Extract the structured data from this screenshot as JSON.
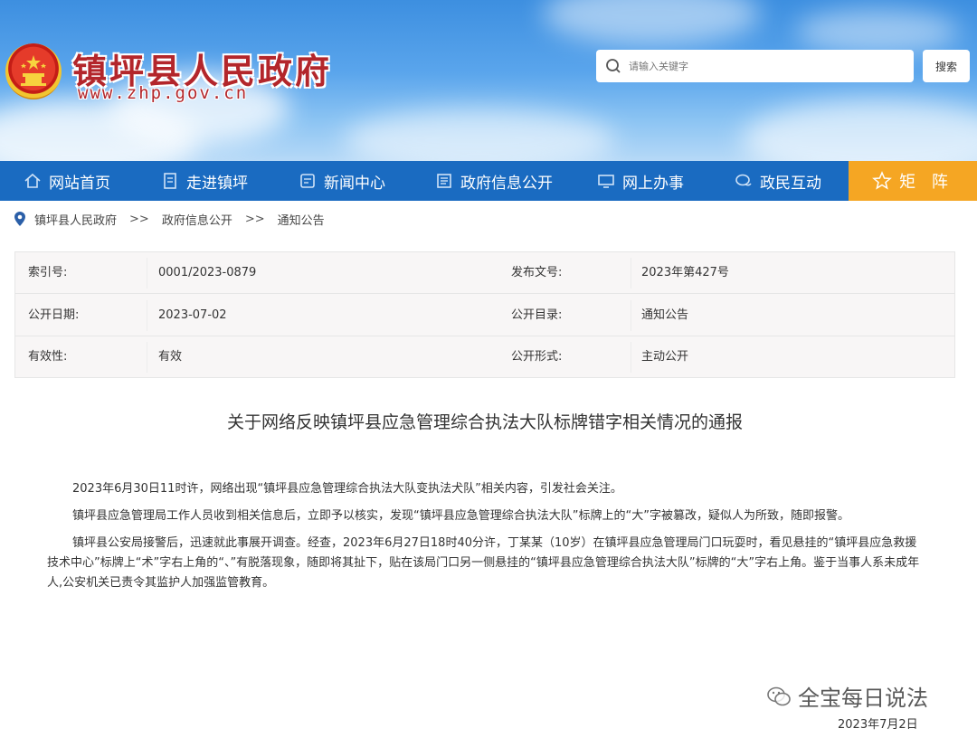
{
  "header": {
    "site_title": "镇坪县人民政府",
    "site_url": "www.zhp.gov.cn",
    "search_placeholder": "请输入关键字",
    "search_button": "搜索"
  },
  "nav": {
    "items": [
      {
        "label": "网站首页",
        "icon": "home-icon"
      },
      {
        "label": "走进镇坪",
        "icon": "document-icon"
      },
      {
        "label": "新闻中心",
        "icon": "news-icon"
      },
      {
        "label": "政府信息公开",
        "icon": "info-icon"
      },
      {
        "label": "网上办事",
        "icon": "monitor-icon"
      },
      {
        "label": "政民互动",
        "icon": "chat-icon"
      },
      {
        "label": "矩 阵",
        "icon": "star-icon"
      }
    ],
    "highlight_color": "#f5a623",
    "bar_color": "#1a6bc1"
  },
  "breadcrumb": {
    "items": [
      "镇坪县人民政府",
      "政府信息公开",
      "通知公告"
    ],
    "separator": ">>"
  },
  "meta": {
    "rows": [
      {
        "label1": "索引号:",
        "value1": "0001/2023-0879",
        "label2": "发布文号:",
        "value2": "2023年第427号"
      },
      {
        "label1": "公开日期:",
        "value1": "2023-07-02",
        "label2": "公开目录:",
        "value2": "通知公告"
      },
      {
        "label1": "有效性:",
        "value1": "有效",
        "label2": "公开形式:",
        "value2": "主动公开"
      }
    ]
  },
  "article": {
    "title": "关于网络反映镇坪县应急管理综合执法大队标牌错字相关情况的通报",
    "paragraphs": [
      "2023年6月30日11时许，网络出现“镇坪县应急管理综合执法大队变执法犬队”相关内容，引发社会关注。",
      "镇坪县应急管理局工作人员收到相关信息后，立即予以核实，发现“镇坪县应急管理综合执法大队”标牌上的“大”字被篡改，疑似人为所致，随即报警。",
      "镇坪县公安局接警后，迅速就此事展开调查。经查，2023年6月27日18时40分许，丁某某（10岁）在镇坪县应急管理局门口玩耍时，看见悬挂的“镇坪县应急救援技术中心”标牌上“术”字右上角的“、”有脱落现象，随即将其扯下，贴在该局门口另一侧悬挂的“镇坪县应急管理综合执法大队”标牌的“大”字右上角。鉴于当事人系未成年人,公安机关已责令其监护人加强监管教育。"
    ]
  },
  "watermark": {
    "text": "全宝每日说法"
  },
  "footer": {
    "date": "2023年7月2日"
  }
}
